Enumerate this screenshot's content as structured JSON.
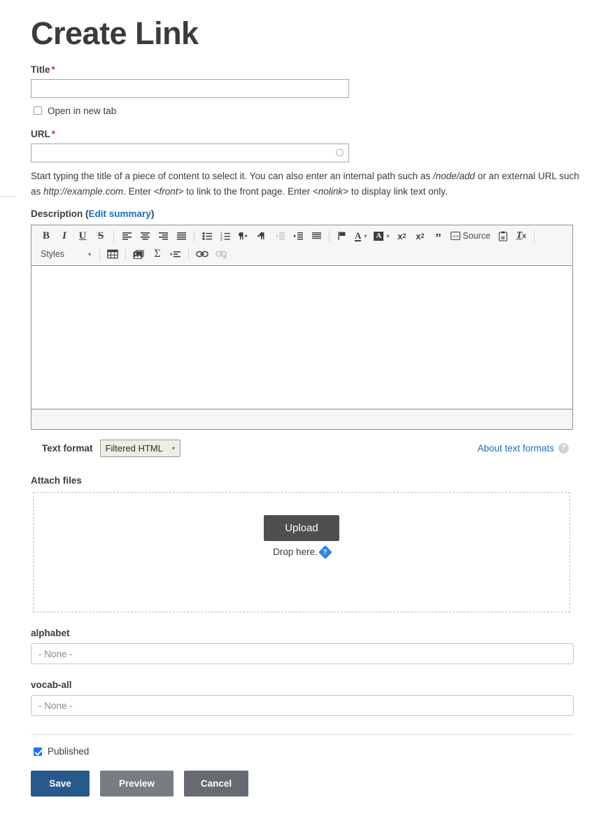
{
  "page": {
    "title": "Create Link"
  },
  "title_field": {
    "label": "Title",
    "required_mark": "*",
    "value": "",
    "placeholder": ""
  },
  "open_new_tab": {
    "label": "Open in new tab",
    "checked": false
  },
  "url_field": {
    "label": "URL",
    "required_mark": "*",
    "value": "",
    "placeholder": "",
    "throbber_icon": "circle-throbber-icon",
    "help_parts": {
      "p1": "Start typing the title of a piece of content to select it. You can also enter an internal path such as ",
      "i1": "/node/add",
      "p2": " or an external URL such as ",
      "i2": "http://example.com",
      "p3": ". Enter ",
      "i3": "<front>",
      "p4": " to link to the front page. Enter ",
      "i4": "<nolink>",
      "p5": " to display link text only."
    }
  },
  "description": {
    "label": "Description",
    "open_paren": "(",
    "edit_summary_link": "Edit summary",
    "close_paren": ")",
    "body_value": ""
  },
  "editor": {
    "toolbar_row1": [
      {
        "name": "bold-icon",
        "glyph": "B",
        "style": "bold",
        "disabled": false
      },
      {
        "name": "italic-icon",
        "glyph": "I",
        "style": "italic",
        "disabled": false
      },
      {
        "name": "underline-icon",
        "glyph": "U",
        "style": "underline",
        "disabled": false
      },
      {
        "name": "strikethrough-icon",
        "glyph": "S",
        "style": "strike",
        "disabled": false
      },
      {
        "name": "separator",
        "glyph": "",
        "style": "sep",
        "disabled": false
      },
      {
        "name": "align-left-icon",
        "glyph": "",
        "style": "alignleft",
        "disabled": false
      },
      {
        "name": "align-center-icon",
        "glyph": "",
        "style": "aligncenter",
        "disabled": false
      },
      {
        "name": "align-right-icon",
        "glyph": "",
        "style": "alignright",
        "disabled": false
      },
      {
        "name": "align-justify-icon",
        "glyph": "",
        "style": "alignjustify",
        "disabled": false
      },
      {
        "name": "separator",
        "glyph": "",
        "style": "sep",
        "disabled": false
      },
      {
        "name": "bulleted-list-icon",
        "glyph": "",
        "style": "bullist",
        "disabled": false
      },
      {
        "name": "numbered-list-icon",
        "glyph": "",
        "style": "numlist",
        "disabled": false
      },
      {
        "name": "text-direction-ltr-icon",
        "glyph": "",
        "style": "ltr",
        "disabled": false
      },
      {
        "name": "text-direction-rtl-icon",
        "glyph": "",
        "style": "rtl",
        "disabled": false
      },
      {
        "name": "outdent-icon",
        "glyph": "",
        "style": "outdent",
        "disabled": true
      },
      {
        "name": "indent-icon",
        "glyph": "",
        "style": "indent",
        "disabled": false
      },
      {
        "name": "blockquote-lines-icon",
        "glyph": "",
        "style": "blocklines",
        "disabled": false
      },
      {
        "name": "separator",
        "glyph": "",
        "style": "sep",
        "disabled": false
      },
      {
        "name": "language-flag-icon",
        "glyph": "",
        "style": "flag",
        "disabled": false
      },
      {
        "name": "text-color-icon",
        "glyph": "A",
        "style": "textcolor",
        "disabled": false
      },
      {
        "name": "background-color-icon",
        "glyph": "A",
        "style": "bgcolor",
        "disabled": false
      },
      {
        "name": "superscript-icon",
        "glyph": "",
        "style": "sup",
        "disabled": false
      },
      {
        "name": "subscript-icon",
        "glyph": "",
        "style": "sub",
        "disabled": false
      },
      {
        "name": "blockquote-icon",
        "glyph": "”",
        "style": "quote",
        "disabled": false
      },
      {
        "name": "source-icon",
        "glyph": "",
        "style": "source",
        "disabled": false,
        "label": "Source"
      },
      {
        "name": "paste-from-word-icon",
        "glyph": "",
        "style": "pasteword",
        "disabled": false
      },
      {
        "name": "remove-format-icon",
        "glyph": "",
        "style": "removeformat",
        "disabled": false
      },
      {
        "name": "separator",
        "glyph": "",
        "style": "sep",
        "disabled": false
      }
    ],
    "styles_dropdown": {
      "label": "Styles",
      "caret": "▾"
    },
    "toolbar_row2": [
      {
        "name": "separator",
        "glyph": "",
        "style": "sep",
        "disabled": false
      },
      {
        "name": "table-icon",
        "glyph": "",
        "style": "table",
        "disabled": false
      },
      {
        "name": "separator",
        "glyph": "",
        "style": "sep",
        "disabled": false
      },
      {
        "name": "image-icon",
        "glyph": "",
        "style": "image",
        "disabled": false
      },
      {
        "name": "special-character-icon",
        "glyph": "Σ",
        "style": "sigma",
        "disabled": false
      },
      {
        "name": "insert-list-icon",
        "glyph": "",
        "style": "inslist",
        "disabled": false
      },
      {
        "name": "separator",
        "glyph": "",
        "style": "sep",
        "disabled": false
      },
      {
        "name": "link-icon",
        "glyph": "",
        "style": "link",
        "disabled": false
      },
      {
        "name": "unlink-icon",
        "glyph": "",
        "style": "unlink",
        "disabled": true
      }
    ]
  },
  "text_format": {
    "label": "Text format",
    "selected": "Filtered HTML",
    "caret": "▾",
    "about_link": "About text formats",
    "help_icon": "question-mark-icon",
    "help_glyph": "?"
  },
  "attach_files": {
    "label": "Attach files",
    "upload_button": "Upload",
    "drop_text": "Drop here.",
    "help_icon": "help-diamond-icon",
    "help_glyph": "?"
  },
  "taxonomy": [
    {
      "label": "alphabet",
      "value": "- None -",
      "name": "alphabet-field"
    },
    {
      "label": "vocab-all",
      "value": "- None -",
      "name": "vocab-all-field"
    }
  ],
  "published": {
    "label": "Published",
    "checked": true
  },
  "actions": {
    "save": "Save",
    "preview": "Preview",
    "cancel": "Cancel"
  },
  "colors": {
    "accent_blue": "#1d6fb8",
    "save_blue": "#28598c",
    "gray_button": "#787d84",
    "required_red": "#e02443",
    "upload_gray": "#4f4f4f",
    "help_diamond_blue": "#2f87d8"
  }
}
